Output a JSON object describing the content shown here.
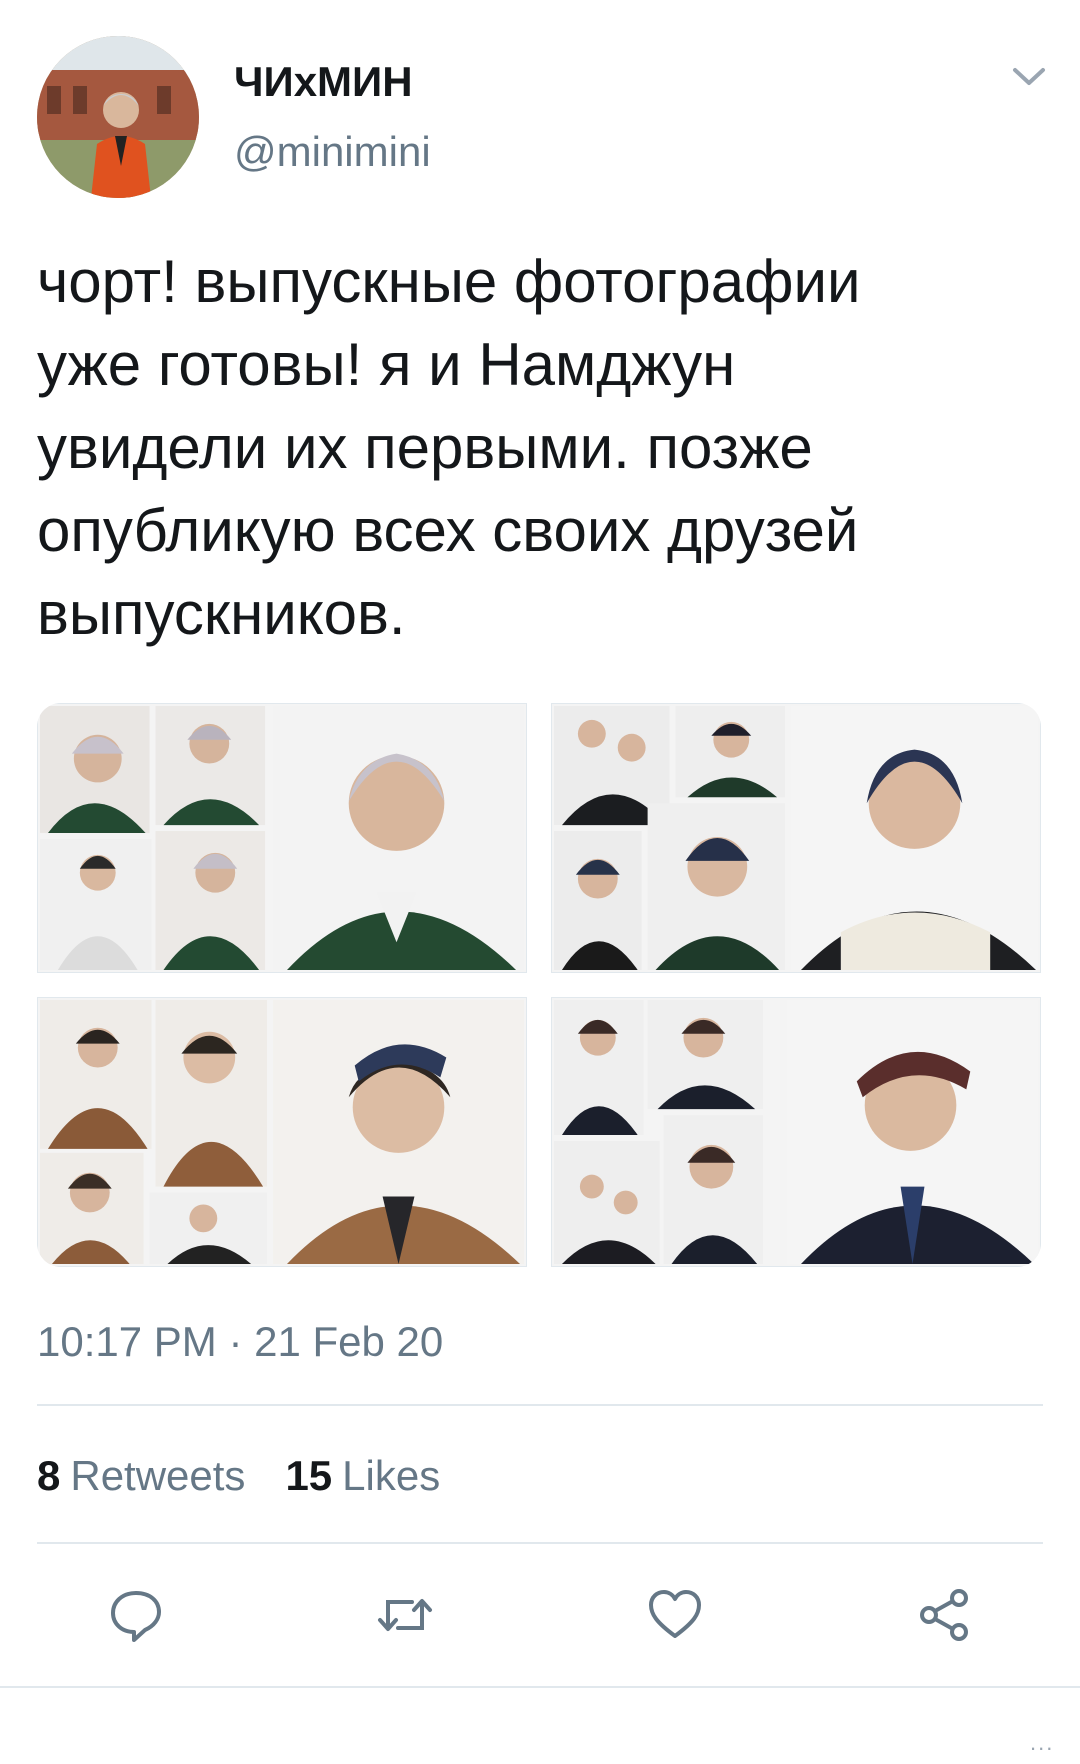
{
  "author": {
    "display_name": "ЧИхМИН",
    "handle": "@minimini"
  },
  "tweet": {
    "text": "чорт! выпускные фотографии\nуже готовы! я и Намджун\nувидели их первыми. позже\nопубликую всех своих друзей\nвыпускников.",
    "timestamp": "10:17 PM · 21 Feb 20"
  },
  "stats": {
    "retweets_count": "8",
    "retweets_label": "Retweets",
    "likes_count": "15",
    "likes_label": "Likes"
  },
  "actions": {
    "reply": "reply-icon",
    "retweet": "retweet-icon",
    "like": "heart-icon",
    "share": "share-icon"
  },
  "colors": {
    "text": "#14171a",
    "secondary": "#657786",
    "divider": "#e1e8ed"
  },
  "overflow": "..."
}
